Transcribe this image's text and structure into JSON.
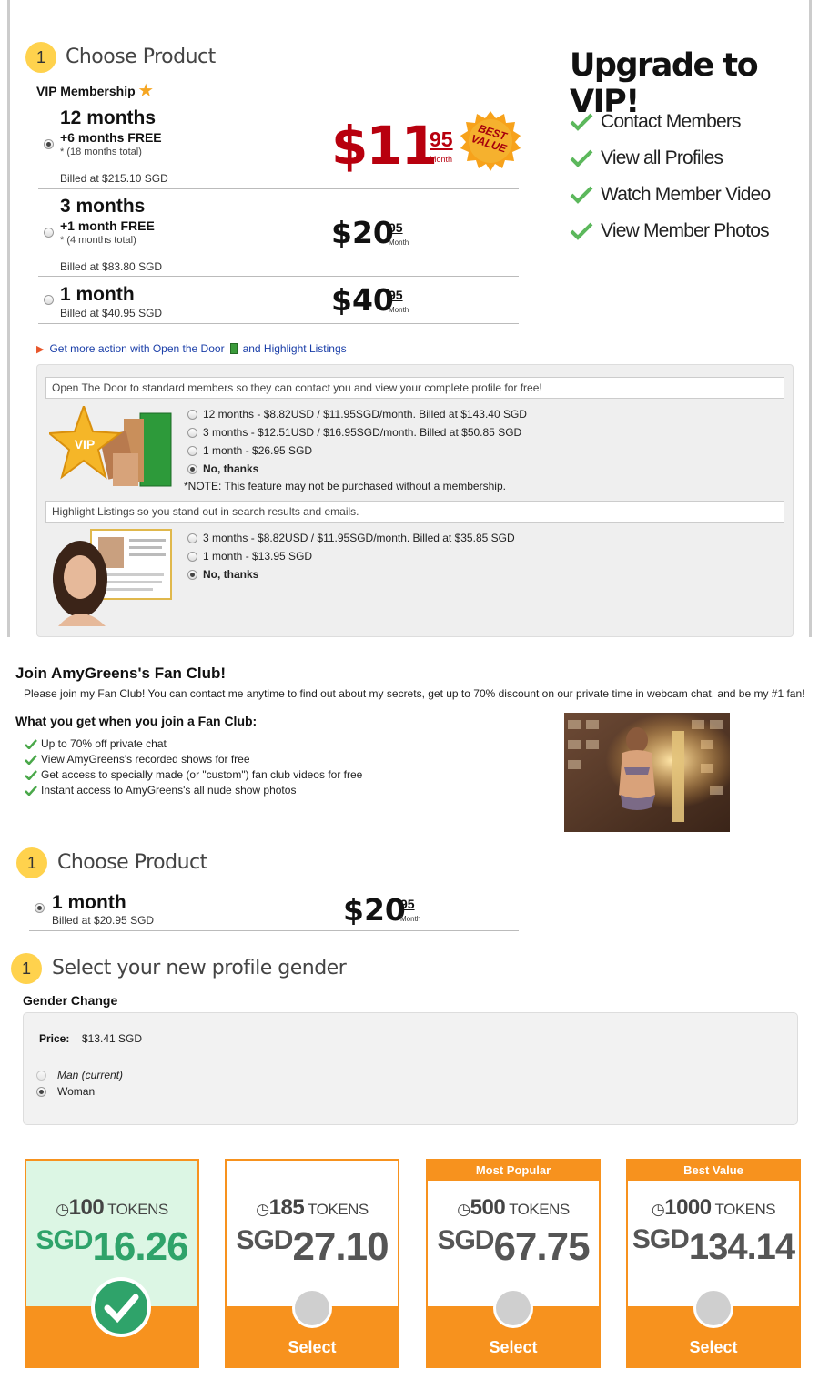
{
  "colors": {
    "accent": "#f7921e",
    "step": "#ffd24d",
    "price_red": "#b8000e",
    "check_green": "#5cb85c",
    "selected_green": "#2fa36a"
  },
  "vip": {
    "step_number": "1",
    "step_title": "Choose Product",
    "membership_label": "VIP Membership",
    "plans": [
      {
        "name": "12 months",
        "free": "+6 months FREE",
        "total": "* (18 months total)",
        "billed": "Billed at $215.10 SGD",
        "dollars": "$11",
        "cents": "95",
        "per": "Month",
        "selected": true
      },
      {
        "name": "3 months",
        "free": "+1 month FREE",
        "total": "* (4 months total)",
        "billed": "Billed at $83.80 SGD",
        "dollars": "$20",
        "cents": "95",
        "per": "Month",
        "selected": false
      },
      {
        "name": "1 month",
        "free": "",
        "total": "",
        "billed": "Billed at $40.95 SGD",
        "dollars": "$40",
        "cents": "95",
        "per": "Month",
        "selected": false
      }
    ],
    "best_value_badge": "BEST VALUE",
    "upgrade_title": "Upgrade to VIP!",
    "benefits": [
      "Contact Members",
      "View all Profiles",
      "Watch Member Video",
      "View Member Photos"
    ],
    "more_action_text": "Get more action with Open the Door",
    "more_action_text2": "and Highlight Listings",
    "open_door": {
      "header": "Open The Door to standard members so they can contact you and view your complete profile for free!",
      "options": [
        "12 months - $8.82USD / $11.95SGD/month. Billed at $143.40 SGD",
        "3 months - $12.51USD / $16.95SGD/month. Billed at $50.85 SGD",
        "1 month - $26.95 SGD",
        "No, thanks"
      ],
      "selected_index": 3,
      "note": "*NOTE: This feature may not be purchased without a membership.",
      "vip_badge": "VIP"
    },
    "highlight": {
      "header": "Highlight Listings so you stand out in search results and emails.",
      "options": [
        "3 months - $8.82USD / $11.95SGD/month. Billed at $35.85 SGD",
        "1 month - $13.95 SGD",
        "No, thanks"
      ],
      "selected_index": 2
    }
  },
  "fan_club": {
    "title": "Join AmyGreens's Fan Club!",
    "description": "Please join my Fan Club! You can contact me anytime to find out about my secrets, get up to 70% discount on our private time in webcam chat, and be my #1 fan!",
    "subtitle": "What you get when you join a Fan Club:",
    "perks": [
      "Up to 70% off private chat",
      "View AmyGreens's recorded shows for free",
      "Get access to specially made (or \"custom\") fan club videos for free",
      "Instant access to AmyGreens's all nude show photos"
    ],
    "step_number": "1",
    "step_title": "Choose Product",
    "plan": {
      "name": "1 month",
      "billed": "Billed at $20.95 SGD",
      "dollars": "$20",
      "cents": "95",
      "per": "Month"
    }
  },
  "gender": {
    "step_number": "1",
    "step_title": "Select your new profile gender",
    "section_label": "Gender Change",
    "price_label": "Price:",
    "price_value": "$13.41 SGD",
    "options": [
      "Man (current)",
      "Woman"
    ],
    "selected_index": 1
  },
  "tokens": [
    {
      "badge": "",
      "count": "100",
      "unit": "TOKENS",
      "currency": "SGD",
      "amount": "16.26",
      "selected": true,
      "select_label": ""
    },
    {
      "badge": "",
      "count": "185",
      "unit": "TOKENS",
      "currency": "SGD",
      "amount": "27.10",
      "selected": false,
      "select_label": "Select"
    },
    {
      "badge": "Most Popular",
      "count": "500",
      "unit": "TOKENS",
      "currency": "SGD",
      "amount": "67.75",
      "selected": false,
      "select_label": "Select"
    },
    {
      "badge": "Best Value",
      "count": "1000",
      "unit": "TOKENS",
      "currency": "SGD",
      "amount": "134.14",
      "selected": false,
      "select_label": "Select"
    }
  ]
}
